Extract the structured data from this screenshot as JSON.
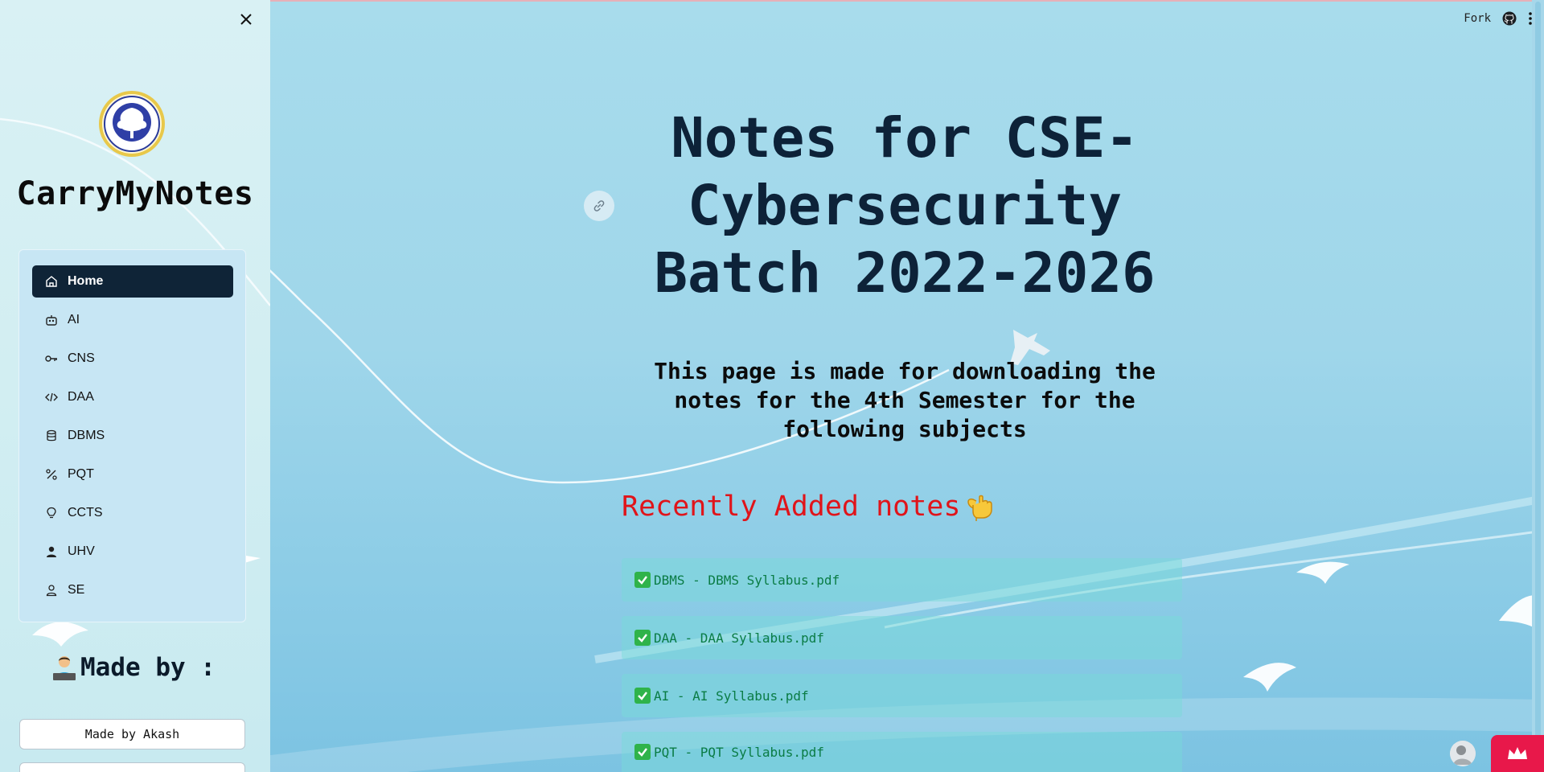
{
  "sidebar": {
    "close_icon": "close-icon",
    "brand": "CarryMyNotes",
    "items": [
      {
        "label": "Home",
        "icon": "home-icon",
        "active": true
      },
      {
        "label": "AI",
        "icon": "robot-icon"
      },
      {
        "label": "CNS",
        "icon": "key-icon"
      },
      {
        "label": "DAA",
        "icon": "code-icon"
      },
      {
        "label": "DBMS",
        "icon": "database-icon"
      },
      {
        "label": "PQT",
        "icon": "percent-icon"
      },
      {
        "label": "CCTS",
        "icon": "lightbulb-icon"
      },
      {
        "label": "UHV",
        "icon": "user-filled-icon"
      },
      {
        "label": "SE",
        "icon": "user-outline-icon"
      }
    ],
    "made_by_title": "Made by :",
    "made_by_button": "Made by Akash"
  },
  "topbar": {
    "fork_label": "Fork",
    "github_icon": "github-icon",
    "menu_icon": "kebab-menu-icon"
  },
  "main": {
    "title_lines": [
      "Notes for CSE-",
      "Cybersecurity",
      "Batch 2022-2026"
    ],
    "description_lines": [
      "This page is made for downloading the",
      "notes for the 4th Semester for the",
      "following subjects"
    ],
    "recent_heading": "Recently Added notes",
    "notes": [
      "DBMS - DBMS Syllabus.pdf",
      "DAA - DAA Syllabus.pdf",
      "AI - AI Syllabus.pdf",
      "PQT - PQT Syllabus.pdf"
    ]
  },
  "colors": {
    "active_nav": "#0f2437",
    "recent_heading": "#e0141a",
    "note_text": "#0a7c45",
    "crown_button": "#e8184a"
  }
}
